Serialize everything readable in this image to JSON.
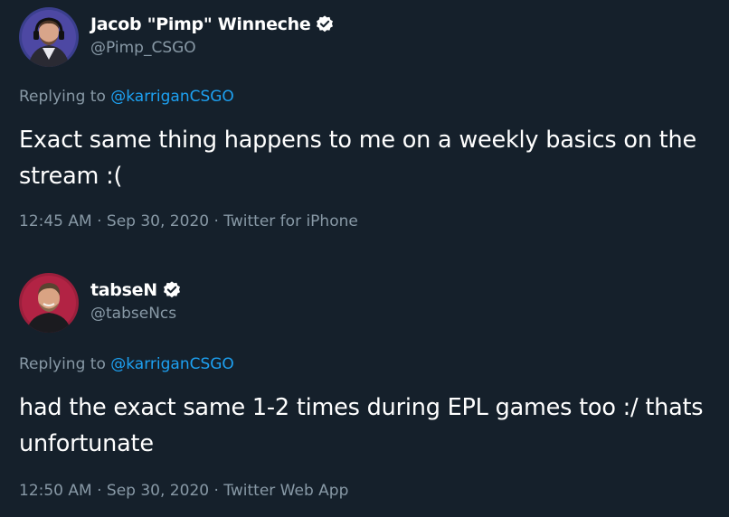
{
  "colors": {
    "background": "#15202b",
    "text_primary": "#ffffff",
    "text_secondary": "#8899a6",
    "link": "#1da1f2"
  },
  "tweets": [
    {
      "display_name": "Jacob \"Pimp\" Winneche",
      "handle": "@Pimp_CSGO",
      "verified_icon": "verified-badge-icon",
      "replying_to_label": "Replying to ",
      "replying_to_handle": "@karriganCSGO",
      "text": "Exact same thing happens to me on a weekly basics on the stream :(",
      "time": "12:45 AM",
      "separator": " · ",
      "date": "Sep 30, 2020",
      "source": "Twitter for iPhone"
    },
    {
      "display_name": "tabseN",
      "handle": "@tabseNcs",
      "verified_icon": "verified-badge-icon",
      "replying_to_label": "Replying to ",
      "replying_to_handle": "@karriganCSGO",
      "text": "had the exact same 1-2 times during EPL games too :/ thats unfortunate",
      "time": "12:50 AM",
      "separator": " · ",
      "date": "Sep 30, 2020",
      "source": "Twitter Web App"
    }
  ]
}
